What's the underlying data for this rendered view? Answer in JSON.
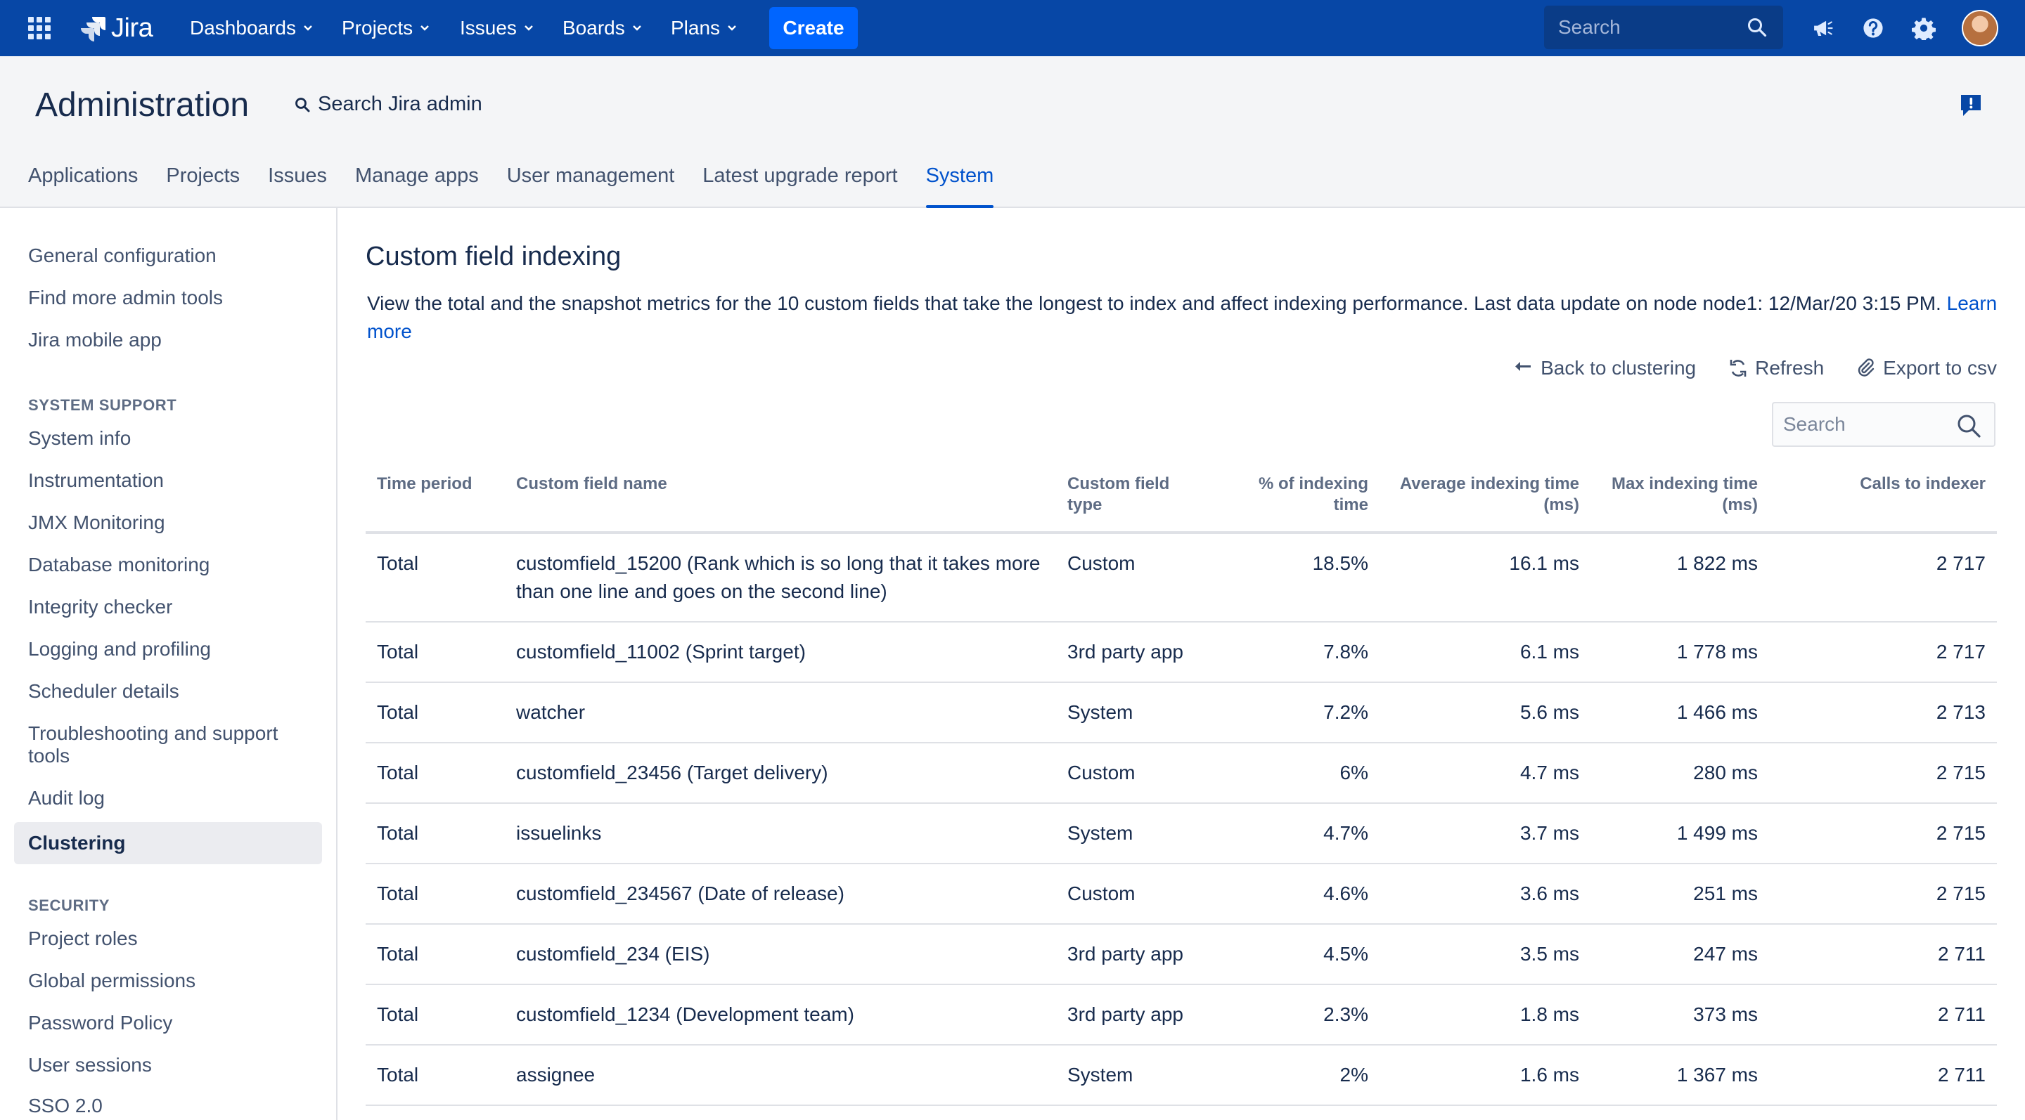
{
  "topnav": {
    "logo_text": "Jira",
    "menus": [
      {
        "label": "Dashboards"
      },
      {
        "label": "Projects"
      },
      {
        "label": "Issues"
      },
      {
        "label": "Boards"
      },
      {
        "label": "Plans"
      }
    ],
    "create_label": "Create",
    "search_placeholder": "Search",
    "icons": [
      "app-switcher-icon",
      "notifications-icon",
      "help-icon",
      "settings-icon",
      "avatar"
    ],
    "brand_color": "#0747a6",
    "create_color": "#0065ff"
  },
  "admin": {
    "title": "Administration",
    "search_label": "Search Jira admin",
    "tabs": [
      {
        "label": "Applications"
      },
      {
        "label": "Projects"
      },
      {
        "label": "Issues"
      },
      {
        "label": "Manage apps"
      },
      {
        "label": "User management"
      },
      {
        "label": "Latest upgrade report"
      },
      {
        "label": "System"
      }
    ],
    "active_tab": "System"
  },
  "sidebar": {
    "top_items": [
      "General configuration",
      "Find more admin tools",
      "Jira mobile app"
    ],
    "system_support_heading": "SYSTEM SUPPORT",
    "system_support_items": [
      "System info",
      "Instrumentation",
      "JMX Monitoring",
      "Database monitoring",
      "Integrity checker",
      "Logging and profiling",
      "Scheduler details",
      "Troubleshooting and support tools",
      "Audit log",
      "Clustering"
    ],
    "selected_item": "Clustering",
    "security_heading": "SECURITY",
    "security_items": [
      "Project roles",
      "Global permissions",
      "Password Policy",
      "User sessions",
      "SSO 2.0"
    ]
  },
  "main": {
    "title": "Custom field indexing",
    "description": "View the total and the snapshot metrics for the 10 custom fields that take the longest to index and affect indexing performance. Last data update on node node1: 12/Mar/20 3:15 PM.",
    "learn_more": "Learn more",
    "actions": {
      "back": "Back to clustering",
      "refresh": "Refresh",
      "export": "Export to csv"
    },
    "search_placeholder": "Search",
    "table": {
      "headers": {
        "period": "Time period",
        "name": "Custom field name",
        "type": "Custom field type",
        "percent": "% of indexing time",
        "avg": "Average indexing time (ms)",
        "max": "Max indexing time (ms)",
        "calls": "Calls to indexer"
      },
      "rows": [
        {
          "period": "Total",
          "name": "customfield_15200 (Rank which is so long that it takes more than one line and goes on the second line)",
          "type": "Custom",
          "percent": "18.5%",
          "avg": "16.1 ms",
          "max": "1 822 ms",
          "calls": "2 717"
        },
        {
          "period": "Total",
          "name": "customfield_11002 (Sprint target)",
          "type": "3rd party app",
          "percent": "7.8%",
          "avg": "6.1 ms",
          "max": "1 778 ms",
          "calls": "2 717"
        },
        {
          "period": "Total",
          "name": "watcher",
          "type": "System",
          "percent": "7.2%",
          "avg": "5.6 ms",
          "max": "1 466 ms",
          "calls": "2 713"
        },
        {
          "period": "Total",
          "name": "customfield_23456 (Target delivery)",
          "type": "Custom",
          "percent": "6%",
          "avg": "4.7 ms",
          "max": "280 ms",
          "calls": "2 715"
        },
        {
          "period": "Total",
          "name": "issuelinks",
          "type": "System",
          "percent": "4.7%",
          "avg": "3.7 ms",
          "max": "1 499 ms",
          "calls": "2 715"
        },
        {
          "period": "Total",
          "name": "customfield_234567 (Date of release)",
          "type": "Custom",
          "percent": "4.6%",
          "avg": "3.6 ms",
          "max": "251 ms",
          "calls": "2 715"
        },
        {
          "period": "Total",
          "name": "customfield_234 (EIS)",
          "type": "3rd party app",
          "percent": "4.5%",
          "avg": "3.5 ms",
          "max": "247 ms",
          "calls": "2 711"
        },
        {
          "period": "Total",
          "name": "customfield_1234 (Development team)",
          "type": "3rd party app",
          "percent": "2.3%",
          "avg": "1.8 ms",
          "max": "373 ms",
          "calls": "2 711"
        },
        {
          "period": "Total",
          "name": "assignee",
          "type": "System",
          "percent": "2%",
          "avg": "1.6 ms",
          "max": "1 367 ms",
          "calls": "2 711"
        }
      ]
    }
  }
}
